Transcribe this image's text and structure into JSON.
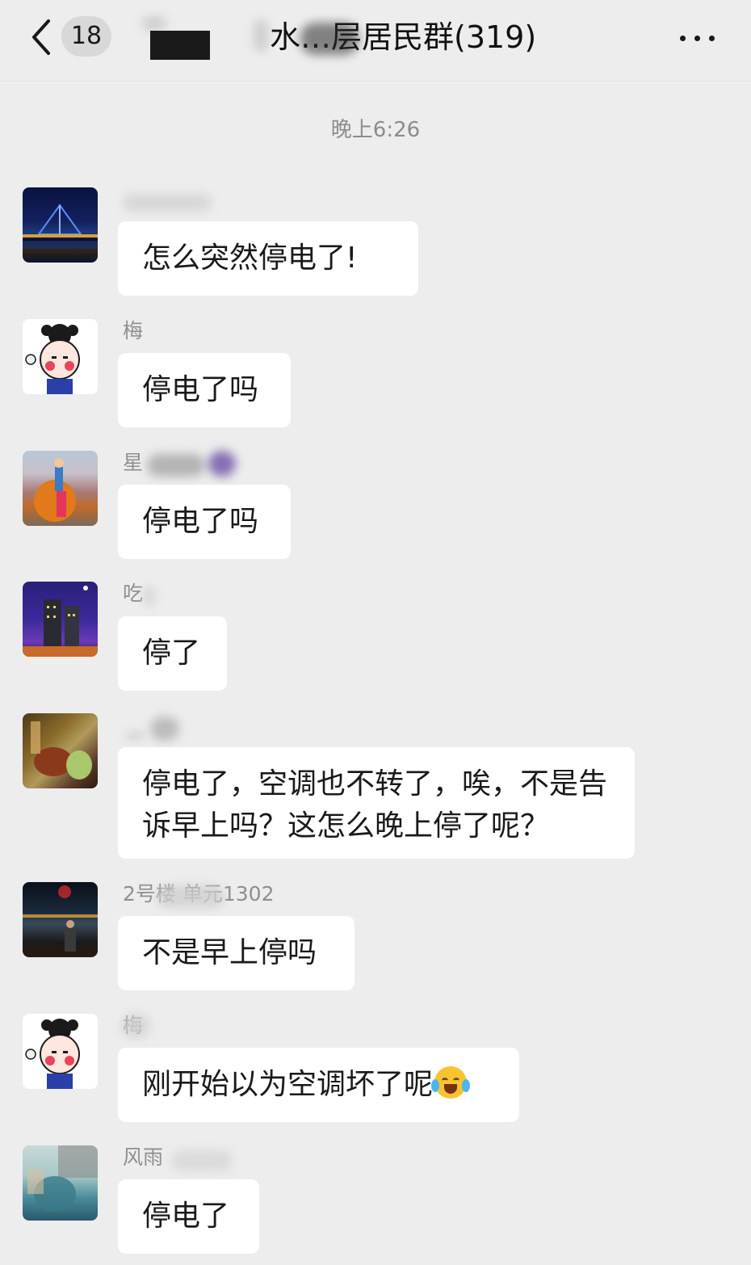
{
  "header": {
    "unread_count": "18",
    "title": "水…层居民群(319)"
  },
  "timestamp": "晚上6:26",
  "messages": [
    {
      "sender": "",
      "text": "怎么突然停电了!"
    },
    {
      "sender": "梅",
      "text": "停电了吗"
    },
    {
      "sender": "星",
      "text": "停电了吗"
    },
    {
      "sender": "吃",
      "text": "停了"
    },
    {
      "sender": "",
      "text": "停电了，空调也不转了，唉，不是告诉早上吗？这怎么晚上停了呢？"
    },
    {
      "sender": "2号楼 单元1302",
      "text": "不是早上停吗"
    },
    {
      "sender": "梅",
      "text": "刚开始以为空调坏了呢"
    },
    {
      "sender": "风雨",
      "text": "停电了"
    }
  ],
  "emoji": {
    "name": "crying-laughing-emoji"
  }
}
